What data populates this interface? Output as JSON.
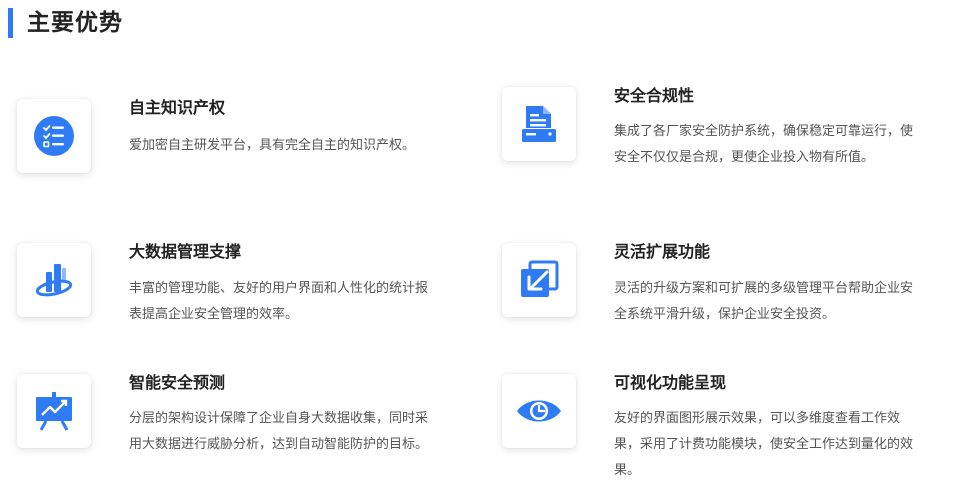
{
  "header": {
    "title": "主要优势",
    "accent_color": "#2f7bf5"
  },
  "features": [
    {
      "title": "自主知识产权",
      "desc": "爱加密自主研发平台，具有完全自主的知识产权。",
      "icon": "checklist-icon"
    },
    {
      "title": "安全合规性",
      "desc": "集成了各厂家安全防护系统，确保稳定可靠运行，使安全不仅仅是合规，更使企业投入物有所值。",
      "icon": "document-printer-icon"
    },
    {
      "title": "大数据管理支撑",
      "desc": "丰富的管理功能、友好的用户界面和人性化的统计报表提高企业安全管理的效率。",
      "icon": "data-orbit-icon"
    },
    {
      "title": "灵活扩展功能",
      "desc": "灵活的升级方案和可扩展的多级管理平台帮助企业安全系统平滑升级，保护企业安全投资。",
      "icon": "expand-arrow-icon"
    },
    {
      "title": "智能安全预测",
      "desc": "分层的架构设计保障了企业自身大数据收集，同时采用大数据进行威胁分析，达到自动智能防护的目标。",
      "icon": "trend-board-icon"
    },
    {
      "title": "可视化功能呈现",
      "desc": "友好的界面图形展示效果，可以多维度查看工作效果，采用了计费功能模块，使安全工作达到量化的效果。",
      "icon": "eye-icon"
    }
  ]
}
